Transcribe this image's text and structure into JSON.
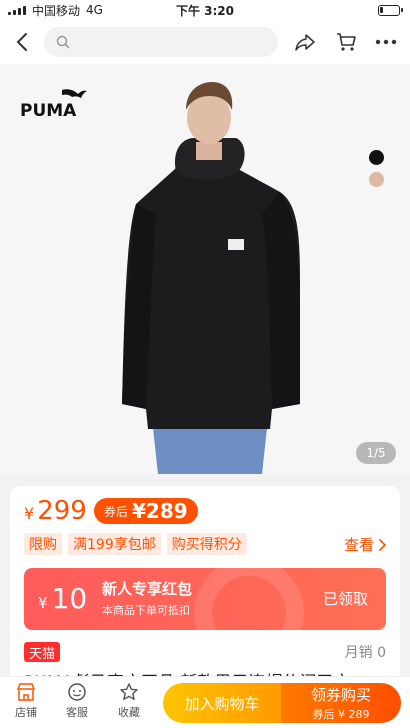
{
  "status_bar": {
    "carrier": "中国移动",
    "network": "4G",
    "time": "下午 3:20",
    "battery_level": 0.2
  },
  "nav": {
    "back_icon": "back-chevron-icon",
    "search_placeholder": "",
    "share_icon": "share-arrow-icon",
    "cart_icon": "cart-icon",
    "more_icon": "more-dots-icon"
  },
  "gallery": {
    "brand_logo_text": "PUMA",
    "indicator": "1/5",
    "swatches": [
      "#111111",
      "#ddb9a2"
    ]
  },
  "price": {
    "currency": "¥",
    "value": "299",
    "coupon_prefix": "券后",
    "coupon_price": "¥289",
    "tags": [
      "限购",
      "满199享包邮",
      "购买得积分"
    ],
    "see_all": "查看"
  },
  "red_packet": {
    "currency": "¥",
    "amount": "10",
    "title": "新人专享红包",
    "subtitle": "本商品下单可抵扣",
    "status": "已领取"
  },
  "store": {
    "badge": "天猫",
    "monthly_sales": "月销 0",
    "title_peek": "PUMA彪马官方正品 新款男子连帽休闲卫衣"
  },
  "bottom_bar": {
    "shop_label": "店铺",
    "service_label": "客服",
    "favorite_label": "收藏",
    "add_cart_label": "加入购物车",
    "buy_label": "领券购买",
    "buy_sub": "券后 ¥ 289"
  },
  "colors": {
    "accent": "#ff5000",
    "red_packet": "#ff5b5b",
    "tmall_red": "#ff2d2d"
  }
}
